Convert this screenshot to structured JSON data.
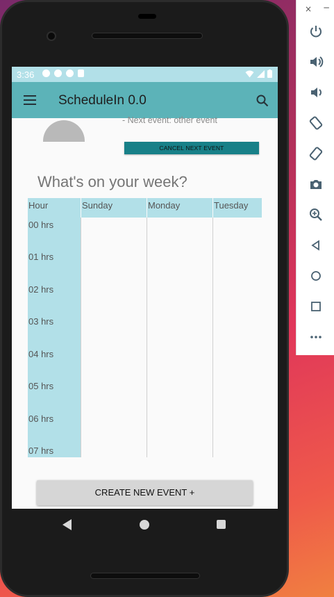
{
  "emulator": {
    "close_label": "×",
    "minimize_label": "−",
    "buttons": [
      "power-icon",
      "volume-up-icon",
      "volume-down-icon",
      "rotate-left-icon",
      "rotate-right-icon",
      "camera-icon",
      "zoom-icon",
      "back-icon",
      "home-icon",
      "overview-icon",
      "more-icon"
    ]
  },
  "status_bar": {
    "time": "3:36"
  },
  "app_bar": {
    "title": "ScheduleIn 0.0"
  },
  "header": {
    "next_event": "- Next event: other event",
    "cancel_label": "CANCEL NEXT EVENT"
  },
  "week": {
    "heading": "What's on your week?",
    "columns": [
      "Hour",
      "Sunday",
      "Monday",
      "Tuesday"
    ],
    "hours": [
      "00 hrs",
      "01 hrs",
      "02 hrs",
      "03 hrs",
      "04 hrs",
      "05 hrs",
      "06 hrs",
      "07 hrs"
    ]
  },
  "actions": {
    "create_label": "CREATE NEW EVENT +"
  },
  "colors": {
    "app_bar": "#5cb3b8",
    "status_bar": "#b2e0e8",
    "cancel_button": "#188088",
    "grid_header": "#b2e0e8"
  }
}
